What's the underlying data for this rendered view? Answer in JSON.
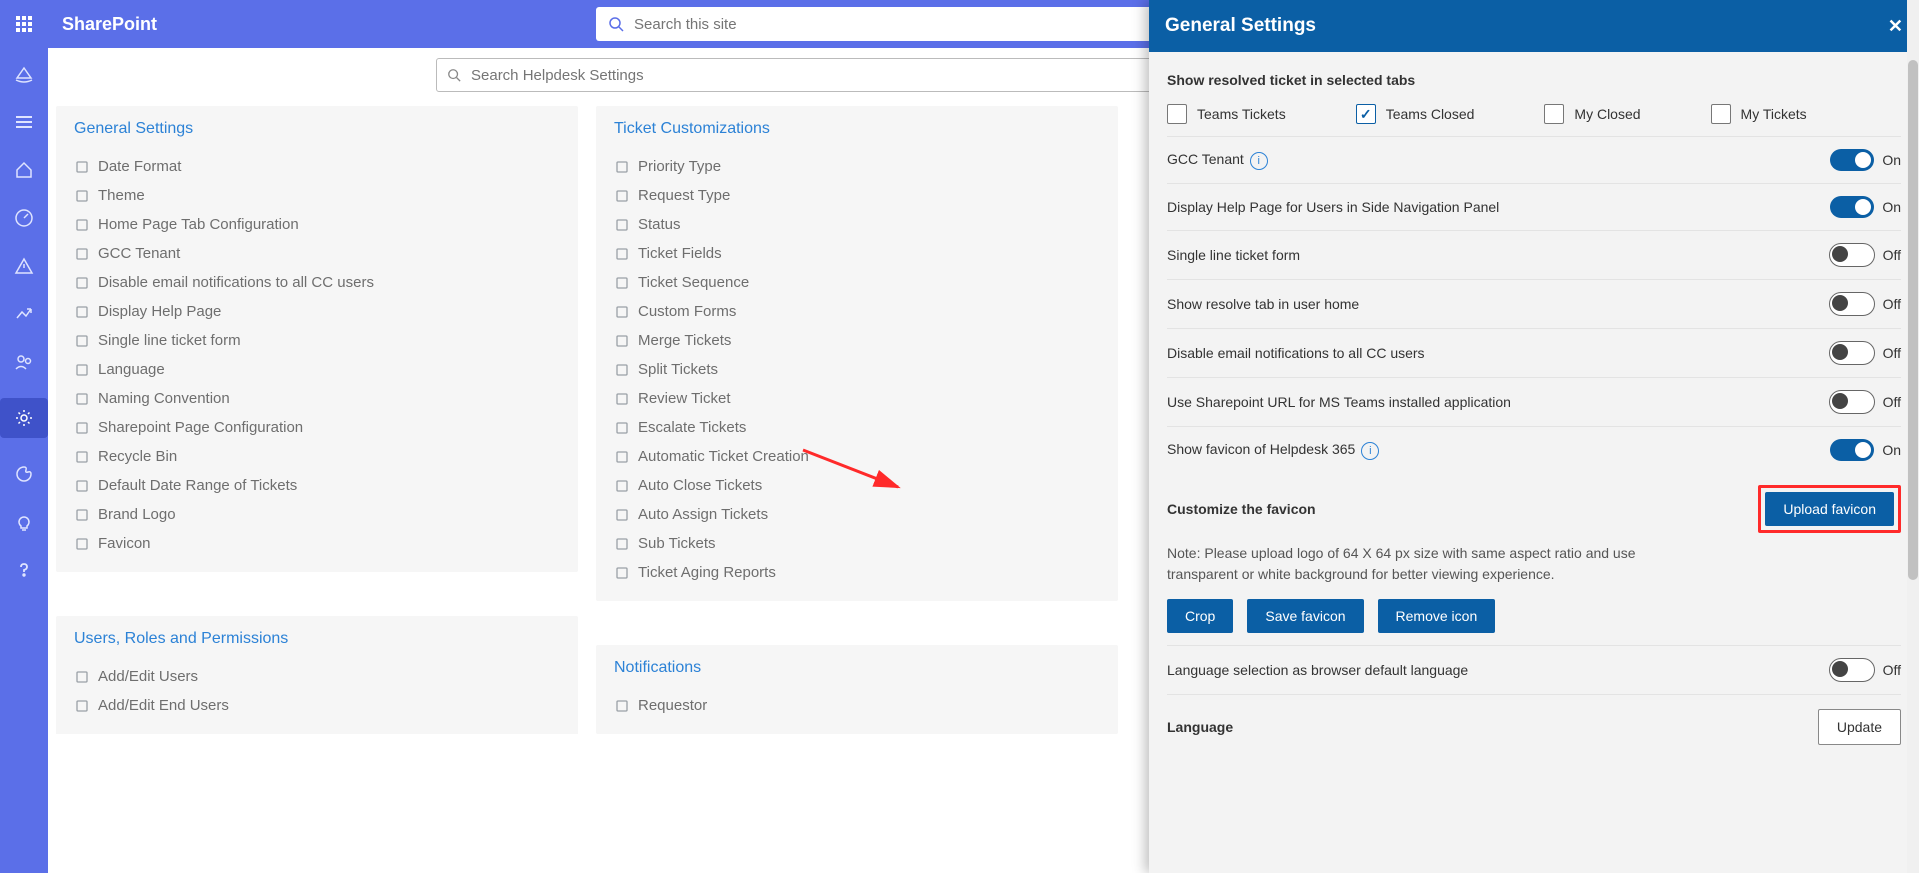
{
  "header": {
    "brand": "SharePoint",
    "searchPlaceholder": "Search this site"
  },
  "mainSearchPlaceholder": "Search Helpdesk Settings",
  "cards": {
    "general": {
      "title": "General Settings",
      "items": [
        "Date Format",
        "Theme",
        "Home Page Tab Configuration",
        "GCC Tenant",
        "Disable email notifications to all CC users",
        "Display Help Page",
        "Single line ticket form",
        "Language",
        "Naming Convention",
        "Sharepoint Page Configuration",
        "Recycle Bin",
        "Default Date Range of Tickets",
        "Brand Logo",
        "Favicon"
      ]
    },
    "users": {
      "title": "Users, Roles and Permissions",
      "items": [
        "Add/Edit Users",
        "Add/Edit End Users"
      ]
    },
    "ticket": {
      "title": "Ticket Customizations",
      "items": [
        "Priority Type",
        "Request Type",
        "Status",
        "Ticket Fields",
        "Ticket Sequence",
        "Custom Forms",
        "Merge Tickets",
        "Split Tickets",
        "Review Ticket",
        "Escalate Tickets",
        "Automatic Ticket Creation",
        "Auto Close Tickets",
        "Auto Assign Tickets",
        "Sub Tickets",
        "Ticket Aging Reports"
      ]
    },
    "notifications": {
      "title": "Notifications",
      "items": [
        "Requestor"
      ]
    }
  },
  "panel": {
    "title": "General Settings",
    "resolvedHeader": "Show resolved ticket in selected tabs",
    "checks": [
      {
        "label": "Teams Tickets",
        "checked": false
      },
      {
        "label": "Teams Closed",
        "checked": true
      },
      {
        "label": "My Closed",
        "checked": false
      },
      {
        "label": "My Tickets",
        "checked": false
      }
    ],
    "rows": [
      {
        "label": "GCC Tenant",
        "value": "On",
        "info": true
      },
      {
        "label": "Display Help Page for Users in Side Navigation Panel",
        "value": "On"
      },
      {
        "label": "Single line ticket form",
        "value": "Off"
      },
      {
        "label": "Show resolve tab in user home",
        "value": "Off"
      },
      {
        "label": "Disable email notifications to all CC users",
        "value": "Off"
      },
      {
        "label": "Use Sharepoint URL for MS Teams installed application",
        "value": "Off"
      },
      {
        "label": "Show favicon of Helpdesk 365",
        "value": "On",
        "info": true
      }
    ],
    "favicon": {
      "title": "Customize the favicon",
      "note": "Note: Please upload logo of 64 X 64 px size with same aspect ratio and use transparent or white background for better viewing experience.",
      "upload": "Upload favicon",
      "crop": "Crop",
      "save": "Save favicon",
      "remove": "Remove icon"
    },
    "langRow": {
      "label": "Language selection as browser default language",
      "value": "Off"
    },
    "languageLabel": "Language",
    "updateLabel": "Update"
  }
}
